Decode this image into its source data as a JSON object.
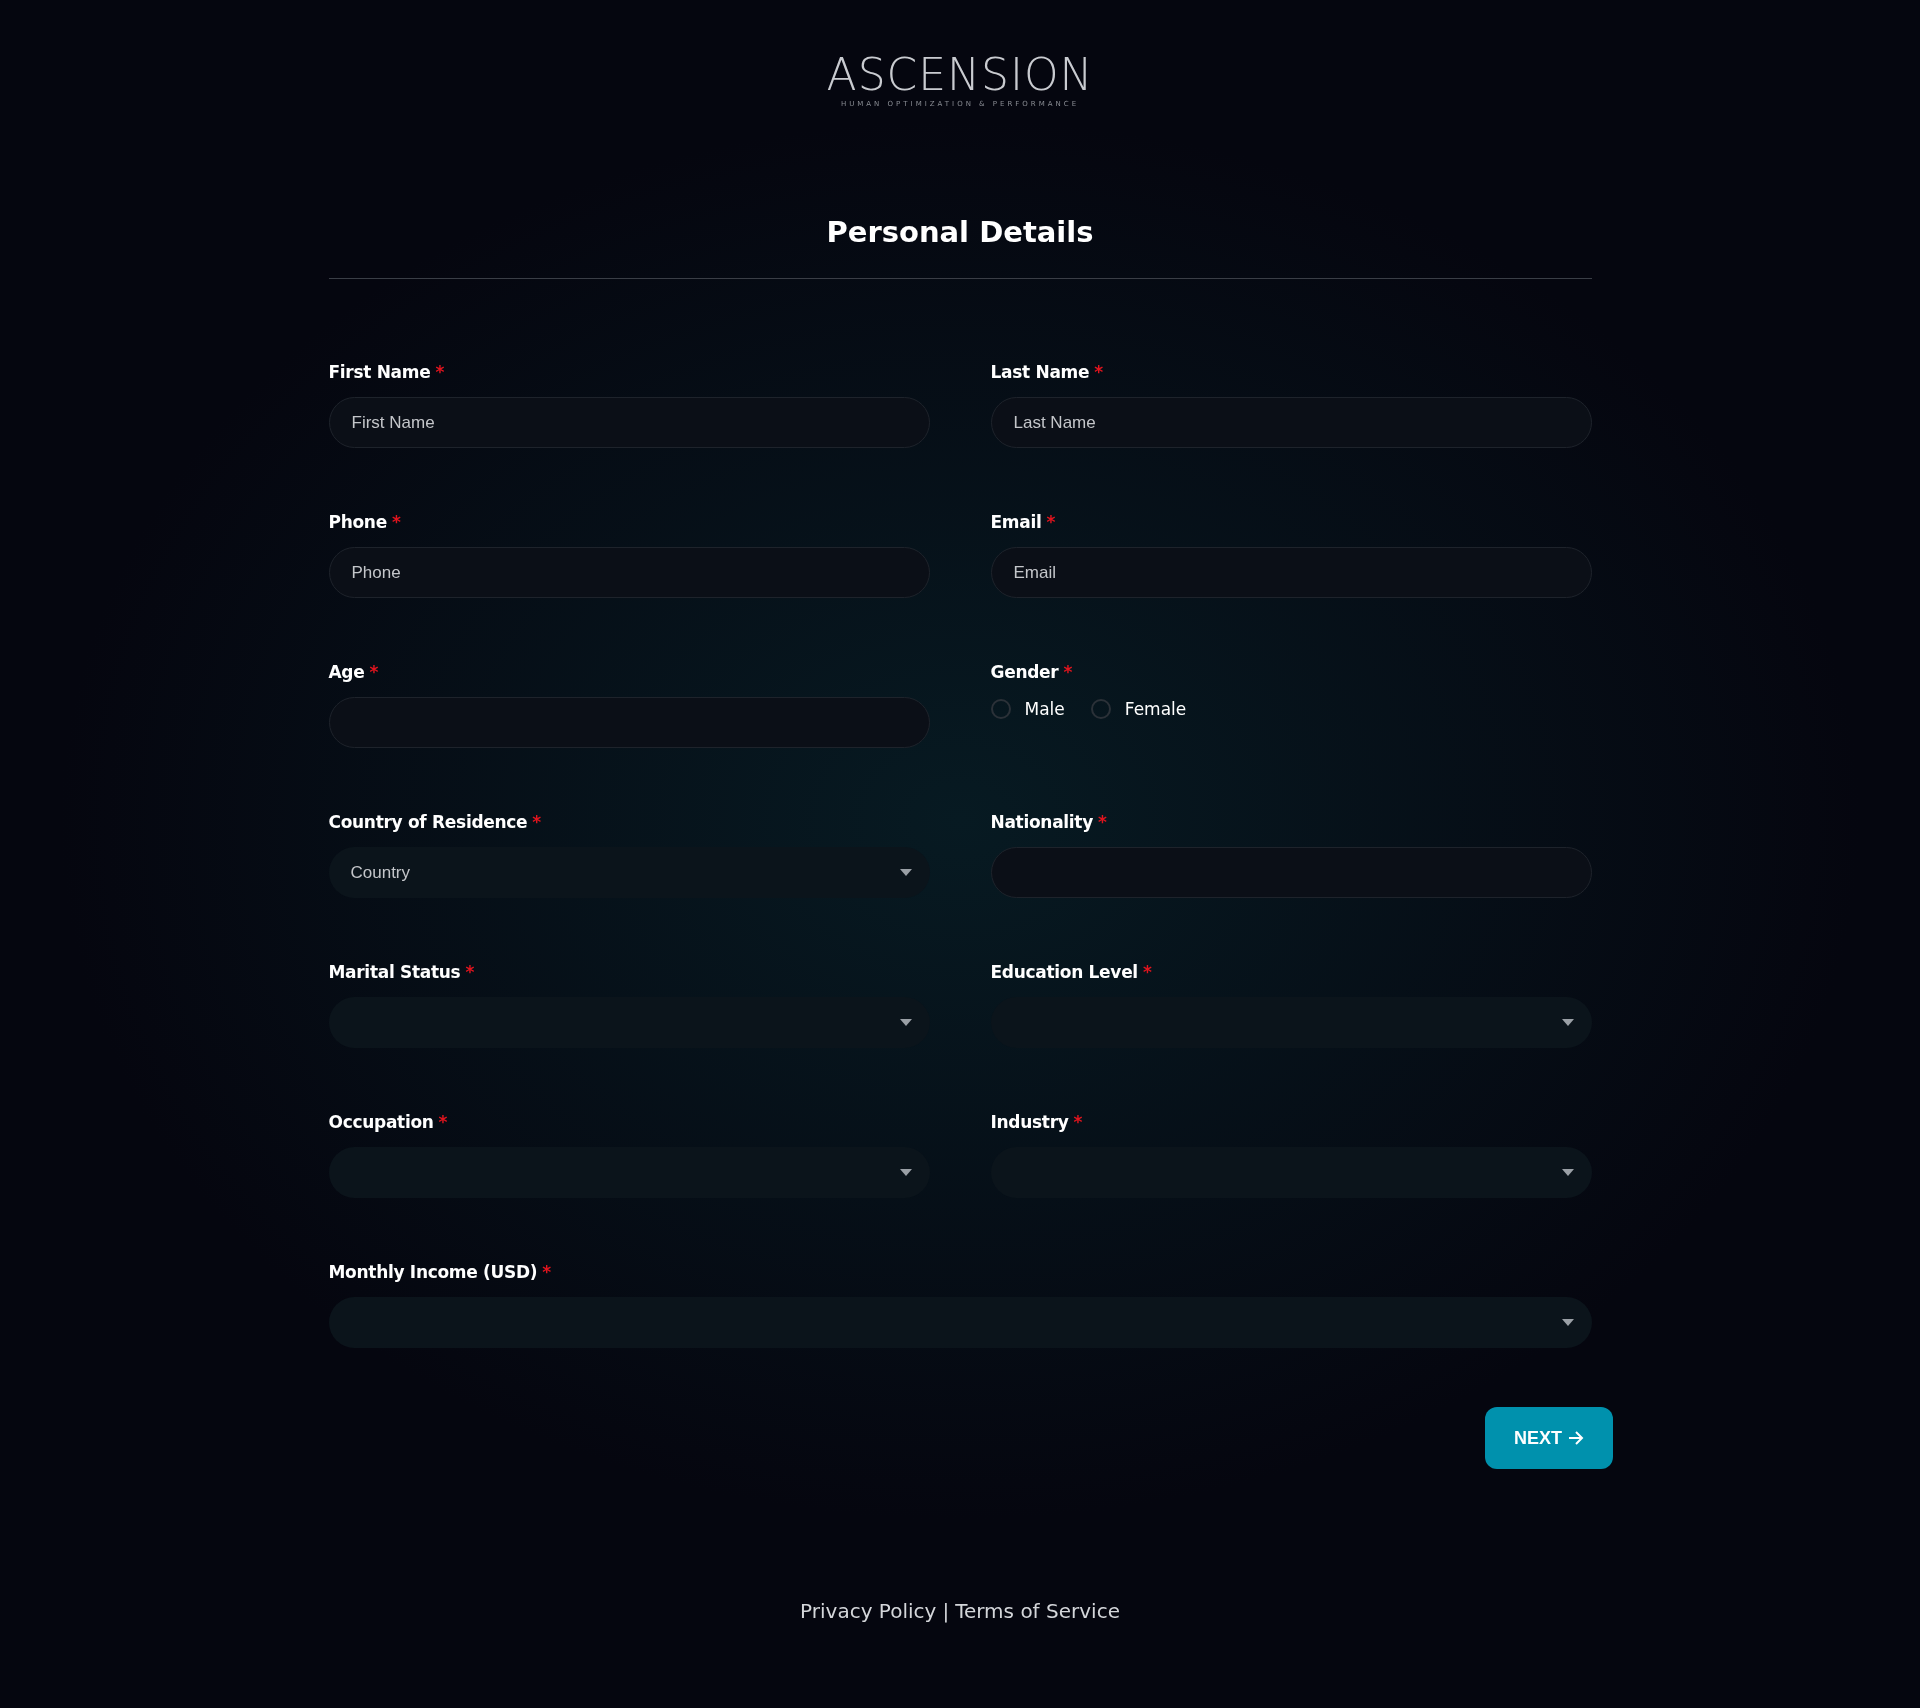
{
  "logo": {
    "wordmark": "ASCENSION",
    "tagline": "HUMAN OPTIMIZATION & PERFORMANCE"
  },
  "title": "Personal Details",
  "fields": [
    {
      "kind": "text",
      "label": "First Name",
      "mark": "*",
      "placeholder": "First Name"
    },
    {
      "kind": "text",
      "label": "Last Name",
      "mark": "*",
      "placeholder": "Last Name"
    },
    {
      "kind": "text",
      "label": "Phone",
      "mark": "*",
      "placeholder": "Phone"
    },
    {
      "kind": "text",
      "label": "Email",
      "mark": "*",
      "placeholder": "Email"
    },
    {
      "kind": "text",
      "label": "Age",
      "mark": "*"
    },
    {
      "kind": "radio",
      "label": "Gender",
      "mark": "*",
      "options": [
        {
          "label": "Male",
          "selected": false
        },
        {
          "label": "Female",
          "selected": false
        }
      ]
    },
    {
      "kind": "select",
      "label": "Country of Residence",
      "mark": "*",
      "placeholder": "Country"
    },
    {
      "kind": "text",
      "label": "Nationality",
      "mark": "*"
    },
    {
      "kind": "select",
      "label": "Marital Status",
      "mark": "*"
    },
    {
      "kind": "select",
      "label": "Education Level",
      "mark": "*"
    },
    {
      "kind": "select",
      "label": "Occupation",
      "mark": "*"
    },
    {
      "kind": "select",
      "label": "Industry",
      "mark": "*"
    },
    {
      "kind": "select",
      "label": "Monthly Income (USD)",
      "mark": "*",
      "wide": true
    }
  ],
  "next_button": "NEXT",
  "footer": {
    "links": [
      "Privacy Policy",
      "Terms of Service"
    ],
    "separator": "|"
  }
}
